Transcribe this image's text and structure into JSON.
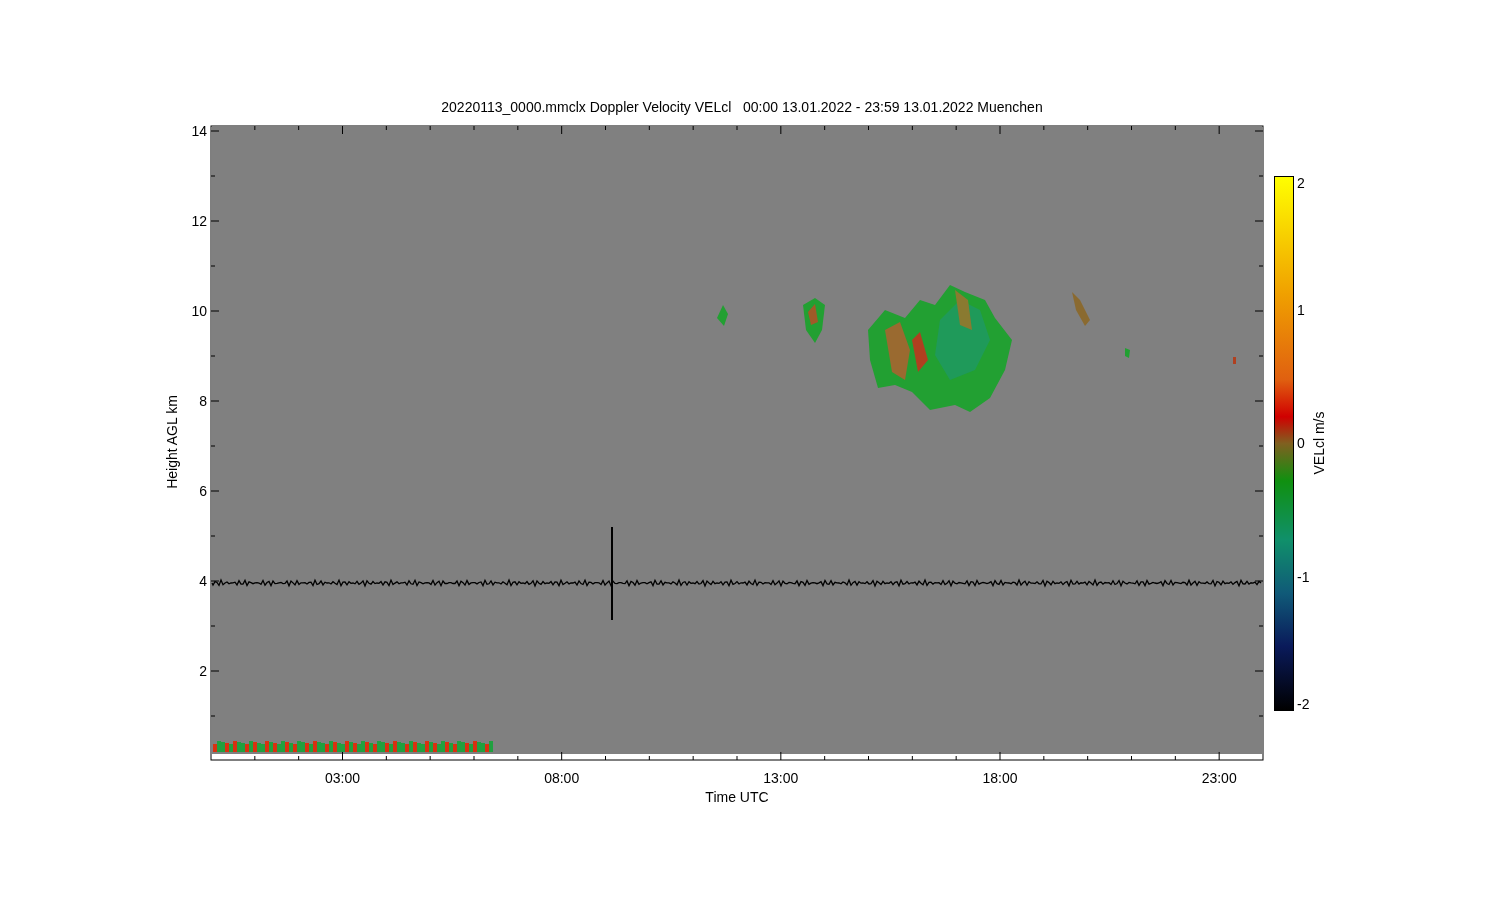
{
  "title": "20220113_0000.mmclx Doppler Velocity VELcl   00:00 13.01.2022 - 23:59 13.01.2022 Muenchen",
  "plot": {
    "ylabel": "Height AGL km",
    "xlabel": "Time UTC",
    "yticks": [
      "14",
      "12",
      "10",
      "8",
      "6",
      "4",
      "2"
    ],
    "xticks": [
      "03:00",
      "08:00",
      "13:00",
      "18:00",
      "23:00"
    ]
  },
  "colorbar": {
    "label": "VELcl m/s",
    "ticks": [
      "2",
      "1",
      "0",
      "-1",
      "-2"
    ]
  }
}
